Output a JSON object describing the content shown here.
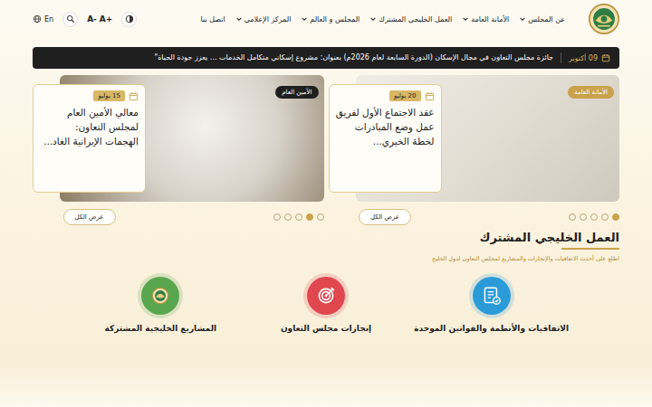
{
  "header": {
    "nav": [
      {
        "label": "عن المجلس",
        "has_menu": true
      },
      {
        "label": "الأمانة العامة",
        "has_menu": true
      },
      {
        "label": "العمل الخليجي المشترك",
        "has_menu": true
      },
      {
        "label": "المجلس و العالم",
        "has_menu": true
      },
      {
        "label": "المركز الإعلامي",
        "has_menu": true
      },
      {
        "label": "اتصل بنا",
        "has_menu": false
      }
    ],
    "tools": {
      "language": "En",
      "font_increase": "A+",
      "font_decrease": "A-"
    }
  },
  "ticker": {
    "date": "09 أكتوبر",
    "text": "جائزة مجلس التعاون في مجال الإسكان (الدورة السابعة لعام 2026م) بعنوان: مشروع إسكاني متكامل الخدمات ... يعزز جودة الحياة\""
  },
  "carousels": [
    {
      "badge": "الأمانة العامة",
      "color": "#c9a24b",
      "date": "20 يوليو",
      "title": "عقد الاجتماع الأول لفريق عمل وضع المبادرات لخطة الخيري...",
      "dots": [
        {
          "selected": true
        },
        {
          "selected": false
        },
        {
          "selected": false
        },
        {
          "selected": false
        },
        {
          "selected": false
        }
      ],
      "button": "عرض الكل"
    },
    {
      "badge": "الأمين العام",
      "color": "#1f1f1f",
      "date": "15 يوليو",
      "title": "معالي الأمين العام لمجلس التعاون: الهجمات الإيرانية الغاد...",
      "dots": [
        {
          "selected": false
        },
        {
          "selected": true
        },
        {
          "selected": false
        },
        {
          "selected": false
        },
        {
          "selected": false
        }
      ],
      "button": "عرض الكل"
    }
  ],
  "section": {
    "title": "العمل الخليجي المشترك",
    "subtitle": "اطلع على أحدث الاتفاقيات والإنجازات والمشاريع لمجلس التعاون لدول الخليج",
    "items": [
      {
        "label": "الاتفاقيات والأنظمة والقوانين الموحدة",
        "kind": "agreements",
        "color": "#2b9bd8"
      },
      {
        "label": "إنجازات مجلس التعاون",
        "kind": "achievements",
        "color": "#e0474f"
      },
      {
        "label": "المشاريع الخليجية المشتركة",
        "kind": "projects",
        "color": "#5aa64f"
      }
    ]
  }
}
